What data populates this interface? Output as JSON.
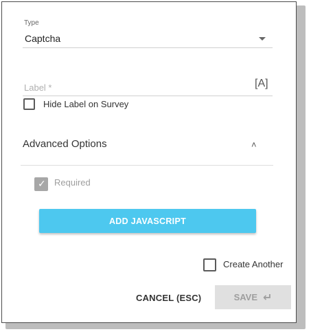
{
  "type_field": {
    "label": "Type",
    "value": "Captcha"
  },
  "label_field": {
    "placeholder": "Label *",
    "translate_icon": "[A]"
  },
  "hide_label": {
    "text": "Hide Label on Survey",
    "checked": false
  },
  "advanced": {
    "title": "Advanced Options",
    "expanded": true
  },
  "required": {
    "text": "Required",
    "checked": true,
    "disabled": true
  },
  "add_js_button": "ADD JAVASCRIPT",
  "create_another": {
    "text": "Create Another",
    "checked": false
  },
  "footer": {
    "cancel": "CANCEL (ESC)",
    "save": "SAVE"
  },
  "colors": {
    "accent": "#4dc8ef",
    "disabled": "#e0e0e0"
  }
}
